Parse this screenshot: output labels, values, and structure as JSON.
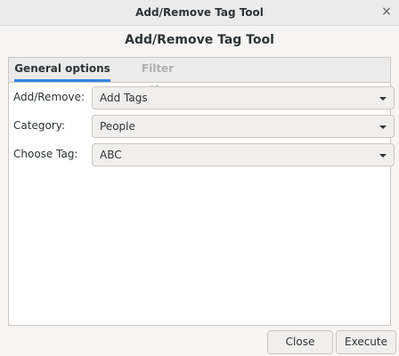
{
  "window": {
    "title": "Add/Remove Tag Tool",
    "close_glyph": "×"
  },
  "dialog": {
    "heading": "Add/Remove Tag Tool"
  },
  "tabs": [
    {
      "label": "General options",
      "active": true
    },
    {
      "label": "Filter options",
      "active": false
    }
  ],
  "form": {
    "add_remove": {
      "label": "Add/Remove:",
      "value": "Add Tags"
    },
    "category": {
      "label": "Category:",
      "value": "People"
    },
    "choose_tag": {
      "label": "Choose Tag:",
      "value": "ABC"
    }
  },
  "buttons": {
    "close": "Close",
    "execute": "Execute"
  },
  "colors": {
    "accent": "#3584e4"
  }
}
